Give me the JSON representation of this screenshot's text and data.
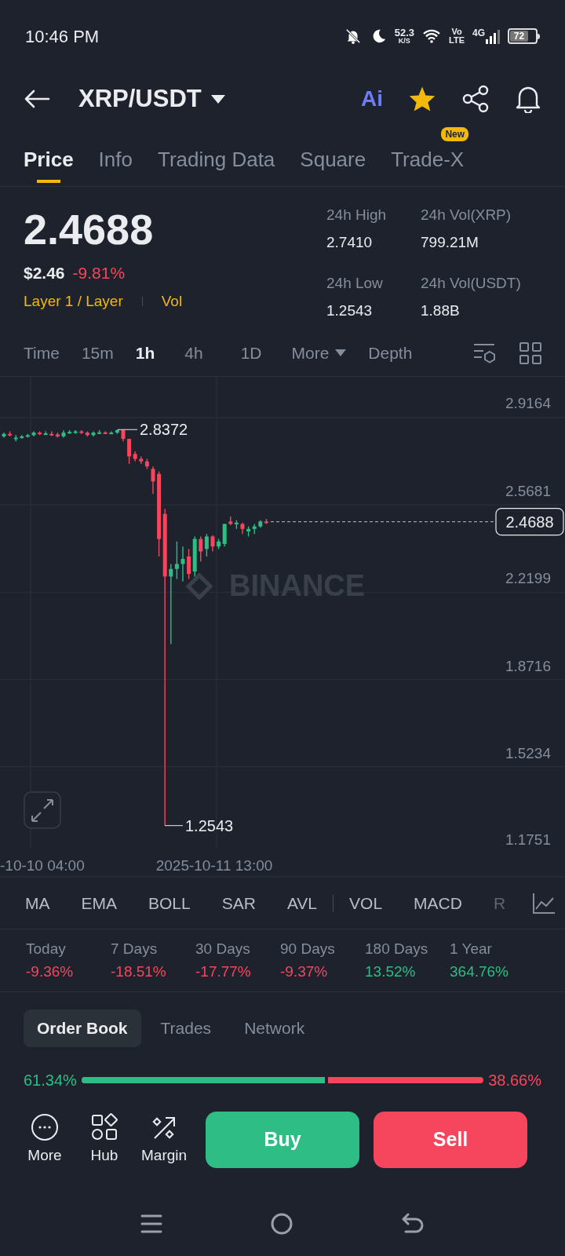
{
  "status_bar": {
    "time": "10:46 PM",
    "speed": "52.3",
    "speed_unit": "K/S",
    "volte_top": "Vo",
    "volte_bottom": "LTE",
    "network": "4G",
    "battery": "72"
  },
  "header": {
    "title": "XRP/USDT",
    "ai_label": "Ai",
    "favorite": true
  },
  "tabs": [
    {
      "label": "Price",
      "selected": true
    },
    {
      "label": "Info",
      "selected": false
    },
    {
      "label": "Trading Data",
      "selected": false
    },
    {
      "label": "Square",
      "selected": false
    },
    {
      "label": "Trade-X",
      "selected": false,
      "badge": "New"
    }
  ],
  "ticker": {
    "price": "2.4688",
    "usd_price": "$2.46",
    "change": "-9.81%",
    "tags": [
      "Layer 1 / Layer",
      "Vol"
    ],
    "stats": [
      {
        "label": "24h High",
        "value": "2.7410"
      },
      {
        "label": "24h Vol(XRP)",
        "value": "799.21M"
      },
      {
        "label": "24h Low",
        "value": "1.2543"
      },
      {
        "label": "24h Vol(USDT)",
        "value": "1.88B"
      }
    ]
  },
  "timeframes": [
    {
      "label": "Time",
      "selected": false
    },
    {
      "label": "15m",
      "selected": false
    },
    {
      "label": "1h",
      "selected": true
    },
    {
      "label": "4h",
      "selected": false
    },
    {
      "label": "1D",
      "selected": false
    }
  ],
  "timeframe_more": "More",
  "depth": "Depth",
  "chart": {
    "y_labels": [
      "2.9164",
      "2.5681",
      "2.2199",
      "1.8716",
      "1.5234",
      "1.1751"
    ],
    "high_marker": "2.8372",
    "low_marker": "1.2543",
    "last_price": "2.4688",
    "x_labels": [
      "-10-10 04:00",
      "2025-10-11 13:00"
    ],
    "watermark": "BINANCE"
  },
  "main_indicators": [
    "MA",
    "EMA",
    "BOLL",
    "SAR",
    "AVL"
  ],
  "sub_indicators": [
    "VOL",
    "MACD",
    "R"
  ],
  "performance": [
    {
      "label": "Today",
      "value": "-9.36%",
      "color": "#f6465d"
    },
    {
      "label": "7 Days",
      "value": "-18.51%",
      "color": "#f6465d"
    },
    {
      "label": "30 Days",
      "value": "-17.77%",
      "color": "#f6465d"
    },
    {
      "label": "90 Days",
      "value": "-9.37%",
      "color": "#f6465d"
    },
    {
      "label": "180 Days",
      "value": "13.52%",
      "color": "#2ebd85"
    },
    {
      "label": "1 Year",
      "value": "364.76%",
      "color": "#2ebd85"
    }
  ],
  "book_tabs": [
    {
      "label": "Order Book",
      "selected": true
    },
    {
      "label": "Trades",
      "selected": false
    },
    {
      "label": "Network",
      "selected": false
    }
  ],
  "ratio": {
    "buy": "61.34%",
    "sell": "38.66%",
    "level": 0.6134
  },
  "actions": [
    {
      "label": "More",
      "kind": "more"
    },
    {
      "label": "Hub",
      "kind": "hub"
    },
    {
      "label": "Margin",
      "kind": "margin"
    }
  ],
  "buy": "Buy",
  "sell": "Sell"
}
